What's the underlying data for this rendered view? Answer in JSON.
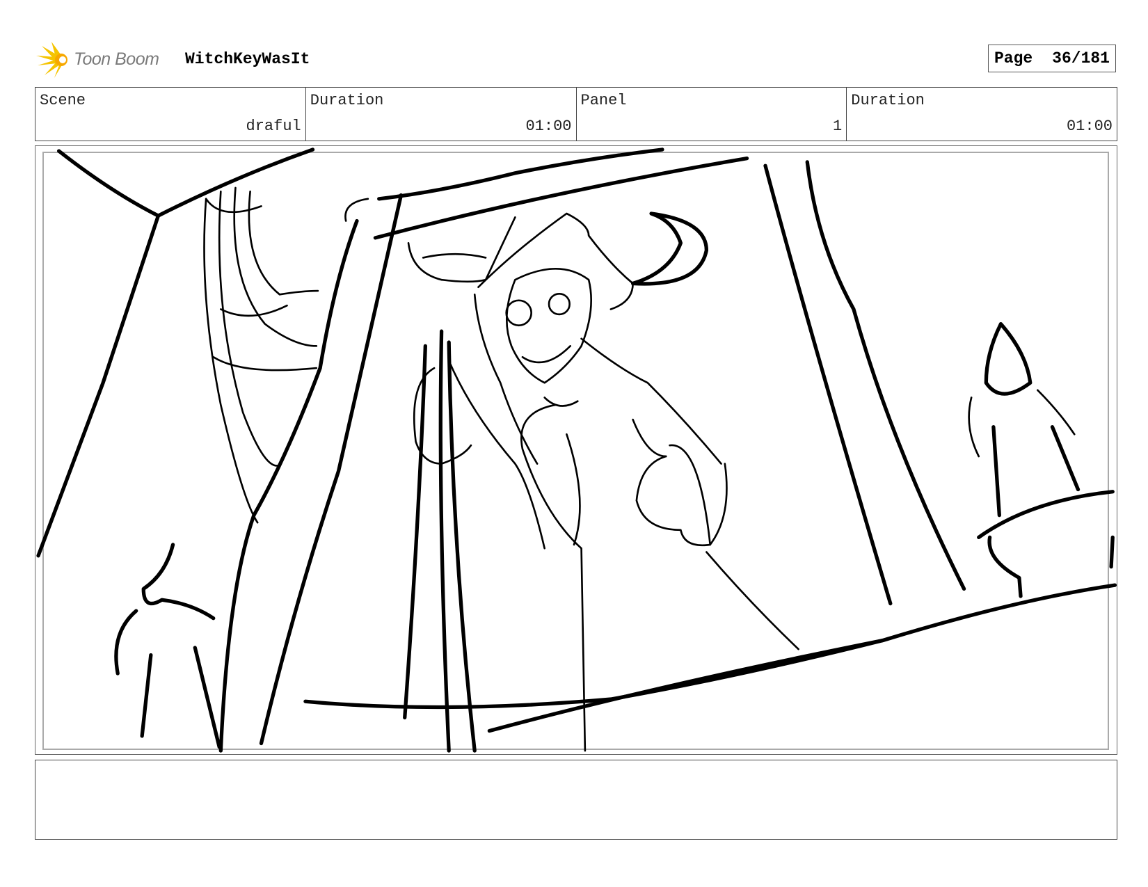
{
  "header": {
    "brand": "Toon Boom",
    "project_title": "WitchKeyWasIt",
    "page_label": "Page",
    "page_value": "36/181"
  },
  "info": [
    {
      "label": "Scene",
      "value": "draful"
    },
    {
      "label": "Duration",
      "value": "01:00"
    },
    {
      "label": "Panel",
      "value": "1"
    },
    {
      "label": "Duration",
      "value": "01:00"
    }
  ],
  "colors": {
    "logo_accent": "#f5c400",
    "logo_text": "#7a7a7a"
  },
  "notes": ""
}
